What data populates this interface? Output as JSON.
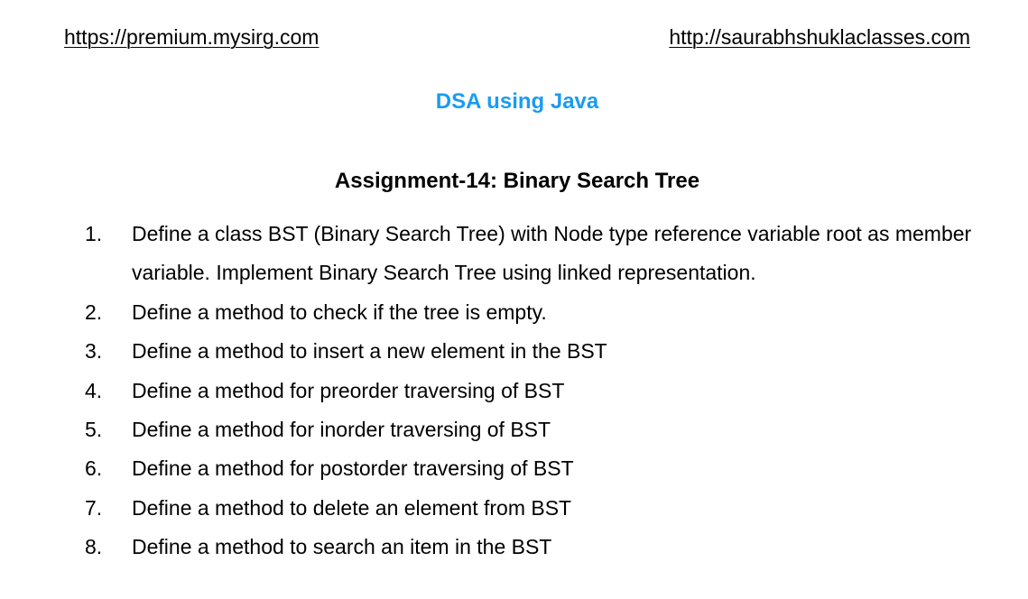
{
  "header": {
    "left_link": "https://premium.mysirg.com",
    "right_link": "http://saurabhshuklaclasses.com"
  },
  "colors": {
    "course_title": "#1a9cf0",
    "text": "#000000"
  },
  "course_title": "DSA using Java",
  "assignment_title": "Assignment-14: Binary Search Tree",
  "tasks": [
    {
      "number": "1.",
      "text": "Define a class BST (Binary Search Tree) with Node type reference variable root as member variable. Implement Binary Search Tree using linked representation."
    },
    {
      "number": "2.",
      "text": "Define a method to check if the tree is empty."
    },
    {
      "number": "3.",
      "text": "Define a method to insert a new element in the BST"
    },
    {
      "number": "4.",
      "text": "Define a method for preorder traversing of BST"
    },
    {
      "number": "5.",
      "text": "Define a method for inorder traversing of BST"
    },
    {
      "number": "6.",
      "text": "Define a method for postorder traversing of BST"
    },
    {
      "number": "7.",
      "text": "Define a method to delete an element from BST"
    },
    {
      "number": "8.",
      "text": "Define a method to search an item in the BST"
    }
  ]
}
